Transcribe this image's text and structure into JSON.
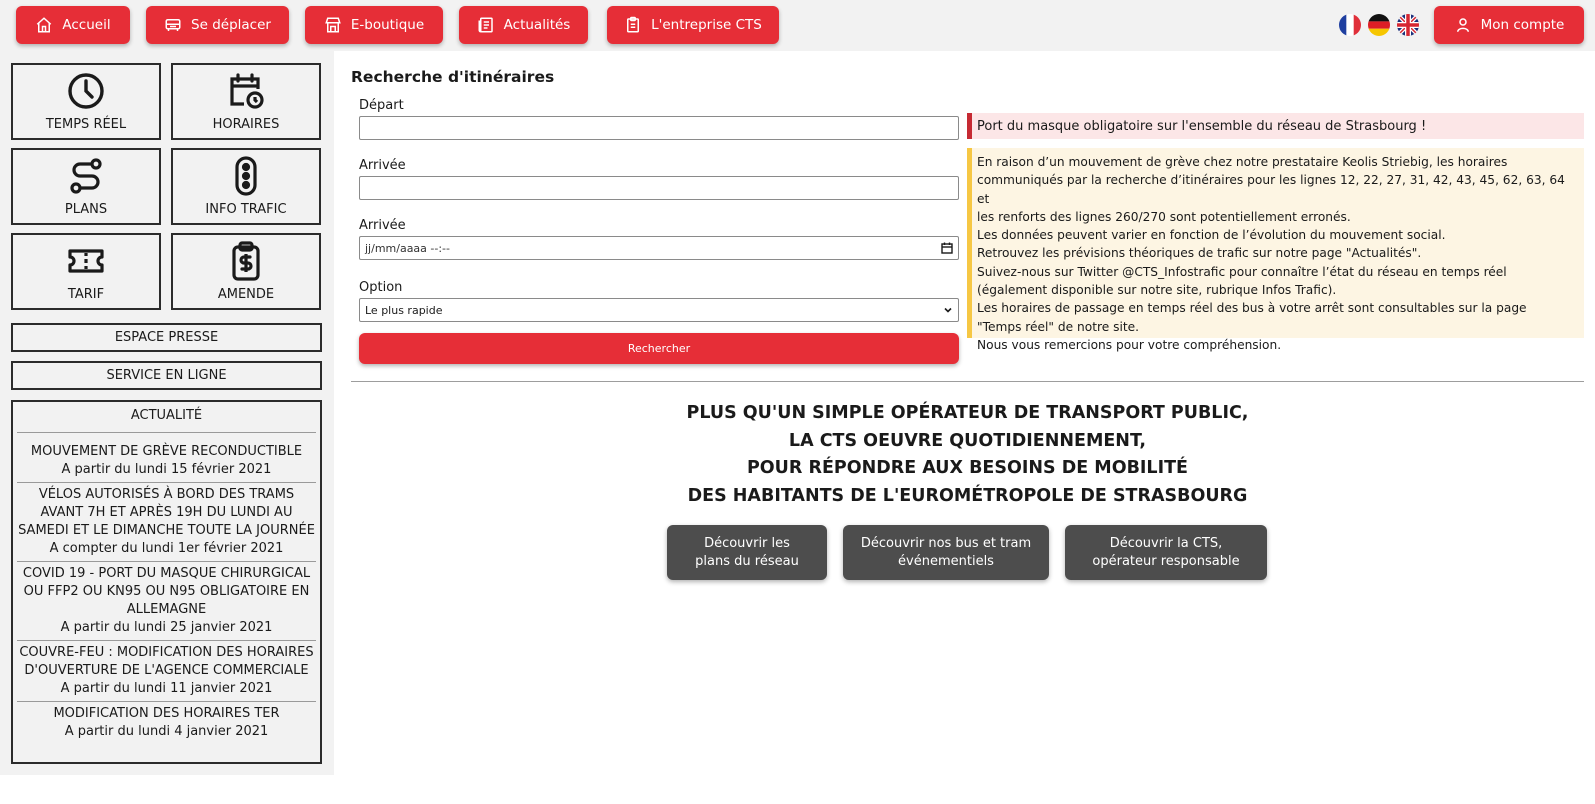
{
  "topnav": {
    "items": [
      {
        "label": "Accueil",
        "icon": "home-icon"
      },
      {
        "label": "Se déplacer",
        "icon": "bus-icon"
      },
      {
        "label": "E-boutique",
        "icon": "shop-icon"
      },
      {
        "label": "Actualités",
        "icon": "news-icon"
      },
      {
        "label": "L'entreprise CTS",
        "icon": "company-icon"
      }
    ],
    "languages": [
      "fr-flag-icon",
      "de-flag-icon",
      "uk-flag-icon"
    ],
    "account_label": "Mon compte"
  },
  "colors": {
    "accent": "#e62e37",
    "dark_button": "#4d4d4d",
    "panel": "#f2f2f2",
    "alert_red": "#c62a33",
    "alert_yellow": "#f6c744"
  },
  "sidebar": {
    "tiles": [
      {
        "label": "TEMPS RÉEL",
        "icon": "clock-icon"
      },
      {
        "label": "HORAIRES",
        "icon": "calendar-clock-icon"
      },
      {
        "label": "PLANS",
        "icon": "route-icon"
      },
      {
        "label": "INFO TRAFIC",
        "icon": "traffic-light-icon"
      },
      {
        "label": "TARIF",
        "icon": "ticket-icon"
      },
      {
        "label": "AMENDE",
        "icon": "clipboard-dollar-icon"
      }
    ],
    "press_label": "ESPACE PRESSE",
    "online_label": "SERVICE EN LIGNE",
    "news_title": "ACTUALITÉ",
    "news": [
      {
        "title": "MOUVEMENT DE GRÈVE RECONDUCTIBLE",
        "date": "A partir du lundi 15 février 2021"
      },
      {
        "title": "VÉLOS AUTORISÉS À BORD DES TRAMS AVANT 7H ET APRÈS 19H DU LUNDI AU SAMEDI ET LE DIMANCHE TOUTE LA JOURNÉE",
        "date": "A compter du lundi 1er février 2021"
      },
      {
        "title": "COVID 19 - PORT DU MASQUE CHIRURGICAL OU FFP2 OU KN95 OU N95 OBLIGATOIRE EN ALLEMAGNE",
        "date": "A partir du lundi 25 janvier 2021"
      },
      {
        "title": "COUVRE-FEU : MODIFICATION DES HORAIRES D'OUVERTURE DE L'AGENCE COMMERCIALE",
        "date": "A partir du lundi 11 janvier 2021"
      },
      {
        "title": "MODIFICATION DES HORAIRES TER",
        "date": "A partir du lundi 4 janvier 2021"
      }
    ]
  },
  "search": {
    "title": "Recherche d'itinéraires",
    "depart_label": "Départ",
    "depart_value": "",
    "arrivee_label": "Arrivée",
    "arrivee_value": "",
    "date_label": "Arrivée",
    "date_placeholder": "jj/mm/aaaa --:--",
    "option_label": "Option",
    "option_selected": "Le plus rapide",
    "submit_label": "Rechercher"
  },
  "alerts": {
    "mask": "Port du masque obligatoire sur l'ensemble du réseau de Strasbourg !",
    "strike_lines": [
      "En raison d’un mouvement de grève chez notre prestataire Keolis Striebig, les horaires",
      "communiqués par la recherche d’itinéraires pour les lignes 12, 22, 27, 31, 42, 43, 45, 62, 63, 64 et",
      "les renforts des lignes 260/270 sont potentiellement erronés.",
      "Les données peuvent varier en fonction de l’évolution du mouvement social.",
      "Retrouvez les prévisions théoriques de trafic sur notre page \"Actualités\".",
      "Suivez-nous sur Twitter @CTS_Infostrafic pour connaître l’état du réseau en temps réel",
      "(également disponible sur notre site, rubrique Infos Trafic).",
      "Les horaires de passage en temps réel des bus à votre arrêt sont consultables sur la page",
      "\"Temps réel\" de notre site.",
      "Nous vous remercions pour votre compréhension."
    ]
  },
  "slogan": [
    "PLUS QU'UN SIMPLE OPÉRATEUR DE TRANSPORT PUBLIC,",
    "LA CTS OEUVRE QUOTIDIENNEMENT,",
    "POUR RÉPONDRE AUX BESOINS DE MOBILITÉ",
    "DES HABITANTS DE L'EUROMÉTROPOLE DE STRASBOURG"
  ],
  "discover": [
    "Découvrir les\nplans du réseau",
    "Découvrir nos bus et tram\névénementiels",
    "Découvrir la CTS,\nopérateur responsable"
  ]
}
